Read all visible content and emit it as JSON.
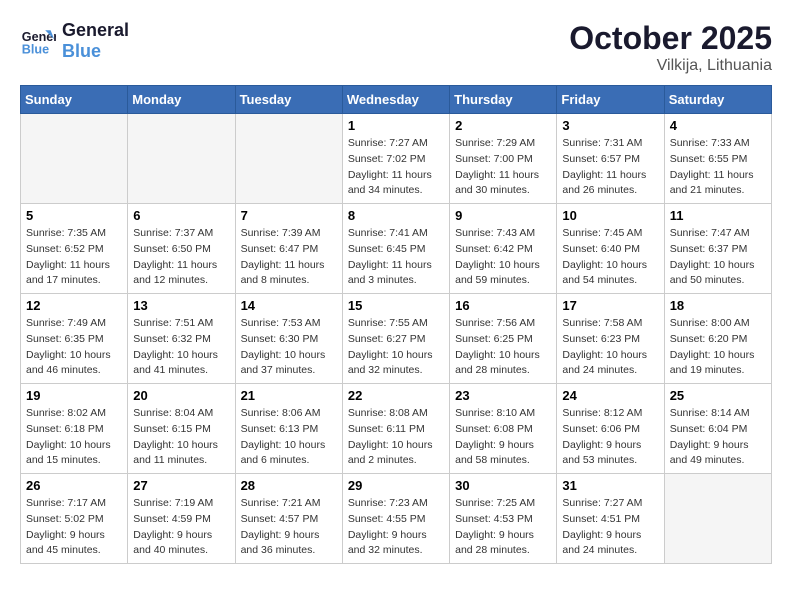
{
  "header": {
    "logo_line1": "General",
    "logo_line2": "Blue",
    "month": "October 2025",
    "location": "Vilkija, Lithuania"
  },
  "weekdays": [
    "Sunday",
    "Monday",
    "Tuesday",
    "Wednesday",
    "Thursday",
    "Friday",
    "Saturday"
  ],
  "weeks": [
    [
      {
        "day": "",
        "info": ""
      },
      {
        "day": "",
        "info": ""
      },
      {
        "day": "",
        "info": ""
      },
      {
        "day": "1",
        "info": "Sunrise: 7:27 AM\nSunset: 7:02 PM\nDaylight: 11 hours\nand 34 minutes."
      },
      {
        "day": "2",
        "info": "Sunrise: 7:29 AM\nSunset: 7:00 PM\nDaylight: 11 hours\nand 30 minutes."
      },
      {
        "day": "3",
        "info": "Sunrise: 7:31 AM\nSunset: 6:57 PM\nDaylight: 11 hours\nand 26 minutes."
      },
      {
        "day": "4",
        "info": "Sunrise: 7:33 AM\nSunset: 6:55 PM\nDaylight: 11 hours\nand 21 minutes."
      }
    ],
    [
      {
        "day": "5",
        "info": "Sunrise: 7:35 AM\nSunset: 6:52 PM\nDaylight: 11 hours\nand 17 minutes."
      },
      {
        "day": "6",
        "info": "Sunrise: 7:37 AM\nSunset: 6:50 PM\nDaylight: 11 hours\nand 12 minutes."
      },
      {
        "day": "7",
        "info": "Sunrise: 7:39 AM\nSunset: 6:47 PM\nDaylight: 11 hours\nand 8 minutes."
      },
      {
        "day": "8",
        "info": "Sunrise: 7:41 AM\nSunset: 6:45 PM\nDaylight: 11 hours\nand 3 minutes."
      },
      {
        "day": "9",
        "info": "Sunrise: 7:43 AM\nSunset: 6:42 PM\nDaylight: 10 hours\nand 59 minutes."
      },
      {
        "day": "10",
        "info": "Sunrise: 7:45 AM\nSunset: 6:40 PM\nDaylight: 10 hours\nand 54 minutes."
      },
      {
        "day": "11",
        "info": "Sunrise: 7:47 AM\nSunset: 6:37 PM\nDaylight: 10 hours\nand 50 minutes."
      }
    ],
    [
      {
        "day": "12",
        "info": "Sunrise: 7:49 AM\nSunset: 6:35 PM\nDaylight: 10 hours\nand 46 minutes."
      },
      {
        "day": "13",
        "info": "Sunrise: 7:51 AM\nSunset: 6:32 PM\nDaylight: 10 hours\nand 41 minutes."
      },
      {
        "day": "14",
        "info": "Sunrise: 7:53 AM\nSunset: 6:30 PM\nDaylight: 10 hours\nand 37 minutes."
      },
      {
        "day": "15",
        "info": "Sunrise: 7:55 AM\nSunset: 6:27 PM\nDaylight: 10 hours\nand 32 minutes."
      },
      {
        "day": "16",
        "info": "Sunrise: 7:56 AM\nSunset: 6:25 PM\nDaylight: 10 hours\nand 28 minutes."
      },
      {
        "day": "17",
        "info": "Sunrise: 7:58 AM\nSunset: 6:23 PM\nDaylight: 10 hours\nand 24 minutes."
      },
      {
        "day": "18",
        "info": "Sunrise: 8:00 AM\nSunset: 6:20 PM\nDaylight: 10 hours\nand 19 minutes."
      }
    ],
    [
      {
        "day": "19",
        "info": "Sunrise: 8:02 AM\nSunset: 6:18 PM\nDaylight: 10 hours\nand 15 minutes."
      },
      {
        "day": "20",
        "info": "Sunrise: 8:04 AM\nSunset: 6:15 PM\nDaylight: 10 hours\nand 11 minutes."
      },
      {
        "day": "21",
        "info": "Sunrise: 8:06 AM\nSunset: 6:13 PM\nDaylight: 10 hours\nand 6 minutes."
      },
      {
        "day": "22",
        "info": "Sunrise: 8:08 AM\nSunset: 6:11 PM\nDaylight: 10 hours\nand 2 minutes."
      },
      {
        "day": "23",
        "info": "Sunrise: 8:10 AM\nSunset: 6:08 PM\nDaylight: 9 hours\nand 58 minutes."
      },
      {
        "day": "24",
        "info": "Sunrise: 8:12 AM\nSunset: 6:06 PM\nDaylight: 9 hours\nand 53 minutes."
      },
      {
        "day": "25",
        "info": "Sunrise: 8:14 AM\nSunset: 6:04 PM\nDaylight: 9 hours\nand 49 minutes."
      }
    ],
    [
      {
        "day": "26",
        "info": "Sunrise: 7:17 AM\nSunset: 5:02 PM\nDaylight: 9 hours\nand 45 minutes."
      },
      {
        "day": "27",
        "info": "Sunrise: 7:19 AM\nSunset: 4:59 PM\nDaylight: 9 hours\nand 40 minutes."
      },
      {
        "day": "28",
        "info": "Sunrise: 7:21 AM\nSunset: 4:57 PM\nDaylight: 9 hours\nand 36 minutes."
      },
      {
        "day": "29",
        "info": "Sunrise: 7:23 AM\nSunset: 4:55 PM\nDaylight: 9 hours\nand 32 minutes."
      },
      {
        "day": "30",
        "info": "Sunrise: 7:25 AM\nSunset: 4:53 PM\nDaylight: 9 hours\nand 28 minutes."
      },
      {
        "day": "31",
        "info": "Sunrise: 7:27 AM\nSunset: 4:51 PM\nDaylight: 9 hours\nand 24 minutes."
      },
      {
        "day": "",
        "info": ""
      }
    ]
  ]
}
